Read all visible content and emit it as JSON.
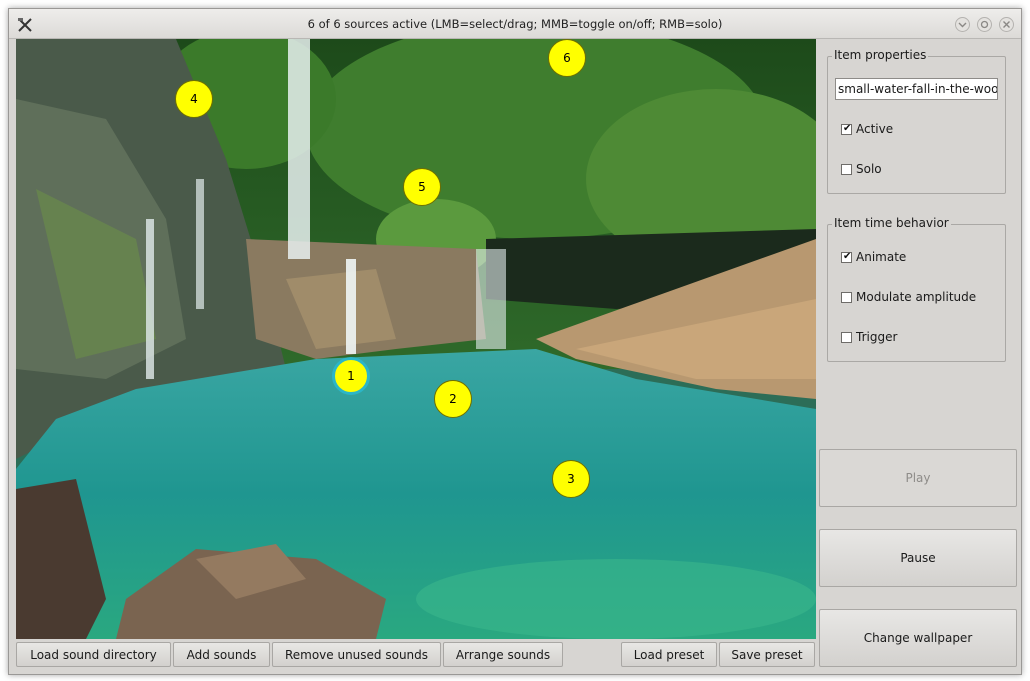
{
  "window": {
    "title": "6 of 6 sources active (LMB=select/drag; MMB=toggle on/off; RMB=solo)",
    "controls": [
      "minimize-icon",
      "maximize-icon",
      "close-icon"
    ]
  },
  "scene": {
    "image_description_icon": "waterfall-wallpaper",
    "markers": [
      {
        "label": "1",
        "selected": true
      },
      {
        "label": "2",
        "selected": false
      },
      {
        "label": "3",
        "selected": false
      },
      {
        "label": "4",
        "selected": false
      },
      {
        "label": "5",
        "selected": false
      },
      {
        "label": "6",
        "selected": false
      }
    ],
    "colors": {
      "marker": "#ffff00",
      "selected_ring": "#2bb6c8"
    }
  },
  "item_properties": {
    "title": "Item properties",
    "name_value": "small-water-fall-in-the-woods",
    "active_label": "Active",
    "active_checked": true,
    "solo_label": "Solo",
    "solo_checked": false
  },
  "item_time": {
    "title": "Item time behavior",
    "animate_label": "Animate",
    "animate_checked": true,
    "modulate_label": "Modulate amplitude",
    "modulate_checked": false,
    "trigger_label": "Trigger",
    "trigger_checked": false
  },
  "side_buttons": {
    "play": "Play",
    "pause": "Pause",
    "change_wallpaper": "Change wallpaper"
  },
  "bottom_buttons": {
    "load_dir": "Load sound directory",
    "add": "Add sounds",
    "remove": "Remove unused sounds",
    "arrange": "Arrange sounds",
    "load_preset": "Load preset",
    "save_preset": "Save preset"
  }
}
